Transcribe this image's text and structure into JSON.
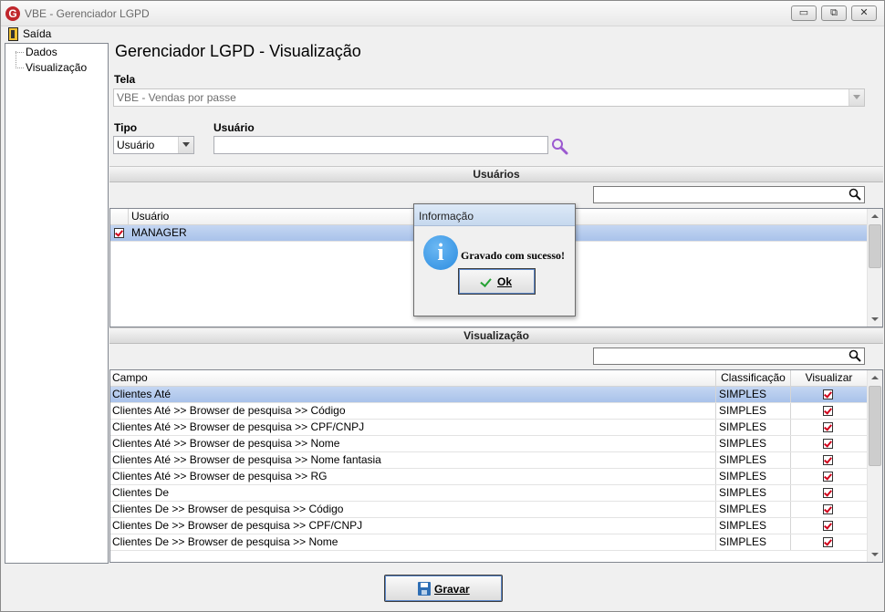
{
  "window": {
    "title": "VBE - Gerenciador LGPD",
    "logo_letter": "G",
    "minimize_glyph": "▭",
    "restore_glyph": "⧉",
    "close_glyph": "✕"
  },
  "menu": {
    "exit_label": "Saída"
  },
  "tree": {
    "items": [
      {
        "label": "Dados"
      },
      {
        "label": "Visualização"
      }
    ]
  },
  "main": {
    "title": "Gerenciador LGPD - Visualização",
    "tela_label": "Tela",
    "tela_value": "VBE - Vendas por passe",
    "tipo_label": "Tipo",
    "tipo_value": "Usuário",
    "usuario_label": "Usuário",
    "usuario_value": ""
  },
  "usuarios_section": {
    "title": "Usuários",
    "search_value": "",
    "columns": [
      "Usuário"
    ],
    "rows": [
      {
        "checked": true,
        "user": "MANAGER"
      }
    ]
  },
  "visualizacao_section": {
    "title": "Visualização",
    "search_value": "",
    "columns": [
      "Campo",
      "Classificação",
      "Visualizar"
    ],
    "rows": [
      {
        "campo": "Clientes Até",
        "classificacao": "SIMPLES",
        "visualizar": true
      },
      {
        "campo": "Clientes Até >> Browser de pesquisa >> Código",
        "classificacao": "SIMPLES",
        "visualizar": true
      },
      {
        "campo": "Clientes Até >> Browser de pesquisa >> CPF/CNPJ",
        "classificacao": "SIMPLES",
        "visualizar": true
      },
      {
        "campo": "Clientes Até >> Browser de pesquisa >> Nome",
        "classificacao": "SIMPLES",
        "visualizar": true
      },
      {
        "campo": "Clientes Até >> Browser de pesquisa >> Nome fantasia",
        "classificacao": "SIMPLES",
        "visualizar": true
      },
      {
        "campo": "Clientes Até >> Browser de pesquisa >> RG",
        "classificacao": "SIMPLES",
        "visualizar": true
      },
      {
        "campo": "Clientes De",
        "classificacao": "SIMPLES",
        "visualizar": true
      },
      {
        "campo": "Clientes De >> Browser de pesquisa >> Código",
        "classificacao": "SIMPLES",
        "visualizar": true
      },
      {
        "campo": "Clientes De >> Browser de pesquisa >> CPF/CNPJ",
        "classificacao": "SIMPLES",
        "visualizar": true
      },
      {
        "campo": "Clientes De >> Browser de pesquisa >> Nome",
        "classificacao": "SIMPLES",
        "visualizar": true
      }
    ]
  },
  "dialog": {
    "title": "Informação",
    "icon_letter": "i",
    "message": "Gravado com sucesso!",
    "ok_label": "Ok"
  },
  "footer": {
    "save_label": "Gravar"
  },
  "colors": {
    "selected_row": "#a9c2ea",
    "check_mark": "#d0021b",
    "info_icon": "#2b8ce0",
    "logo": "#c0262c",
    "search_icon_accent": "#9b59d0"
  }
}
